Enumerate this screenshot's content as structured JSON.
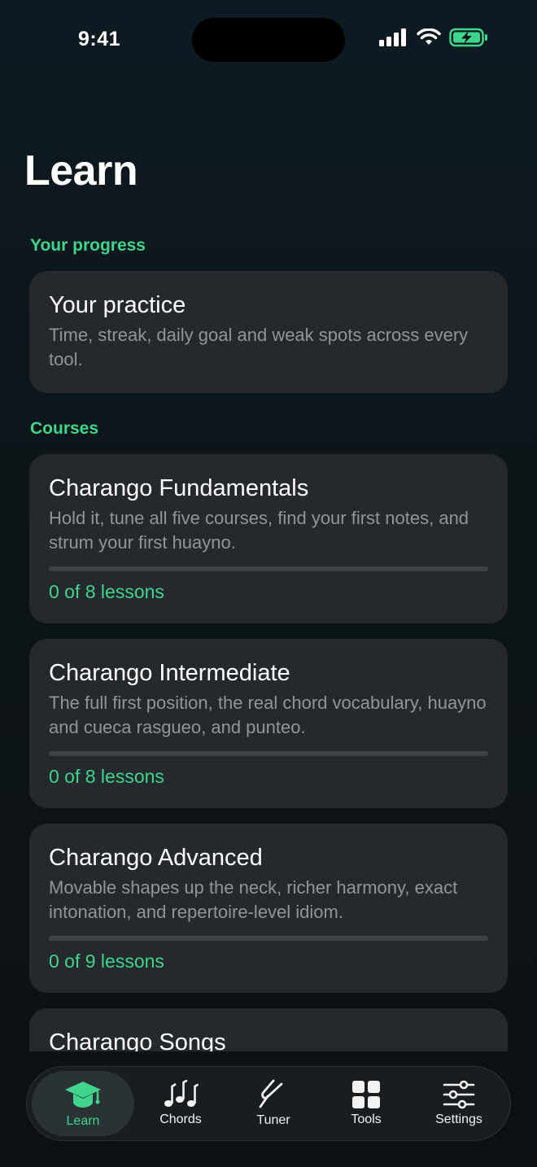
{
  "status_bar": {
    "time": "9:41"
  },
  "page": {
    "title": "Learn"
  },
  "sections": {
    "progress_header": "Your progress",
    "courses_header": "Courses"
  },
  "practice_card": {
    "title": "Your practice",
    "description": "Time, streak, daily goal and weak spots across every tool."
  },
  "courses": [
    {
      "title": "Charango Fundamentals",
      "description": "Hold it, tune all five courses, find your first notes, and strum your first huayno.",
      "progress": "0 of 8 lessons",
      "completed": 0,
      "total": 8
    },
    {
      "title": "Charango Intermediate",
      "description": "The full first position, the real chord vocabulary, huayno and cueca rasgueo, and punteo.",
      "progress": "0 of 8 lessons",
      "completed": 0,
      "total": 8
    },
    {
      "title": "Charango Advanced",
      "description": "Movable shapes up the neck, richer harmony, exact intonation, and repertoire-level idiom.",
      "progress": "0 of 9 lessons",
      "completed": 0,
      "total": 9
    },
    {
      "title": "Charango Songs"
    }
  ],
  "tabs": [
    {
      "label": "Learn",
      "icon": "graduation-cap-icon",
      "active": true
    },
    {
      "label": "Chords",
      "icon": "music-notes-icon",
      "active": false
    },
    {
      "label": "Tuner",
      "icon": "tuning-fork-icon",
      "active": false
    },
    {
      "label": "Tools",
      "icon": "grid-icon",
      "active": false
    },
    {
      "label": "Settings",
      "icon": "sliders-icon",
      "active": false
    }
  ],
  "colors": {
    "accent": "#3fd58d",
    "card": "#25292d",
    "background": "#0d1519"
  }
}
